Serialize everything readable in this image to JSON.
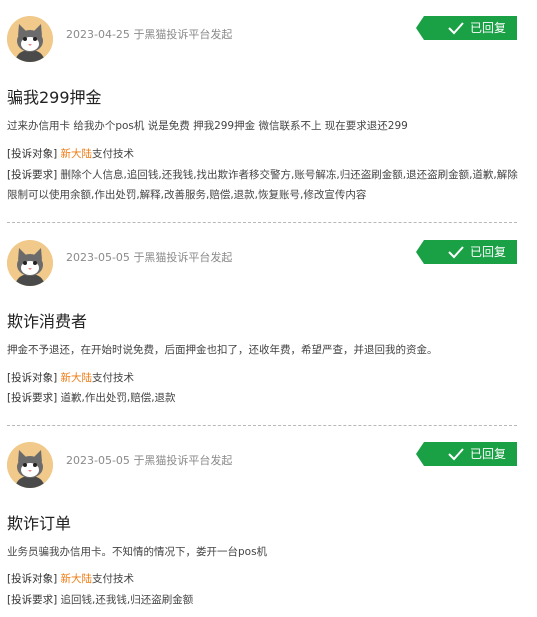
{
  "colors": {
    "badge_green": "#1aa146",
    "highlight_orange": "#ef7a10"
  },
  "complaints": [
    {
      "date": "2023-04-25",
      "platform_text": "于黑猫投诉平台发起",
      "status": "已回复",
      "title": "骗我299押金",
      "description": "过来办信用卡 给我办个pos机 说是免费 押我299押金 微信联系不上 现在要求退还299",
      "target_label": "[投诉对象]",
      "target_highlight": "新大陆",
      "target_rest": "支付技术",
      "request_label": "[投诉要求]",
      "request_text": "删除个人信息,追回钱,还我钱,找出欺诈者移交警方,账号解冻,归还盗刷金额,退还盗刷金额,道歉,解除限制可以使用余额,作出处罚,解释,改善服务,赔偿,退款,恢复账号,修改宣传内容"
    },
    {
      "date": "2023-05-05",
      "platform_text": "于黑猫投诉平台发起",
      "status": "已回复",
      "title": "欺诈消费者",
      "description": "押金不予退还，在开始时说免费，后面押金也扣了，还收年费，希望严查，并退回我的资金。",
      "target_label": "[投诉对象]",
      "target_highlight": "新大陆",
      "target_rest": "支付技术",
      "request_label": "[投诉要求]",
      "request_text": "道歉,作出处罚,赔偿,退款"
    },
    {
      "date": "2023-05-05",
      "platform_text": "于黑猫投诉平台发起",
      "status": "已回复",
      "title": "欺诈订单",
      "description": "业务员骗我办信用卡。不知情的情况下，娄开一台pos机",
      "target_label": "[投诉对象]",
      "target_highlight": "新大陆",
      "target_rest": "支付技术",
      "request_label": "[投诉要求]",
      "request_text": "追回钱,还我钱,归还盗刷金额"
    }
  ]
}
